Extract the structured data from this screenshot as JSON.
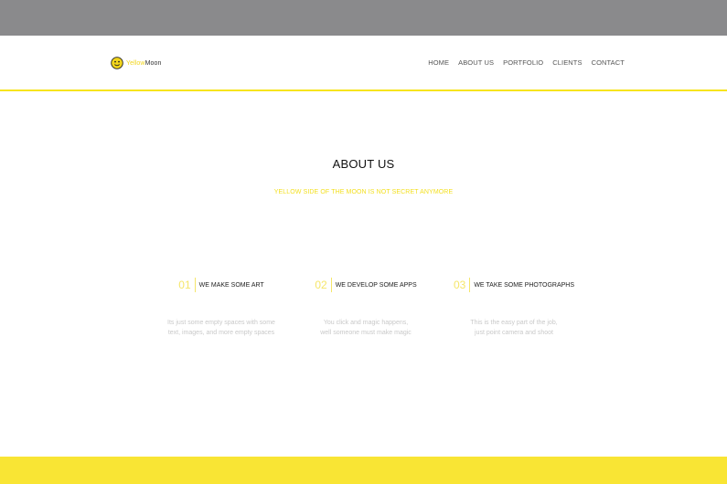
{
  "header": {
    "logo": {
      "word1": "Yellow",
      "word2": "Moon"
    },
    "nav": [
      "HOME",
      "ABOUT US",
      "PORTFOLIO",
      "CLIENTS",
      "CONTACT"
    ]
  },
  "main": {
    "title": "ABOUT US",
    "subtitle": "YELLOW SIDE OF THE MOON IS NOT SECRET ANYMORE",
    "services": [
      {
        "num": "01",
        "title": "WE MAKE SOME ART",
        "desc_line1": "Its just some empty spaces with some",
        "desc_line2": "text, images, and more empty spaces"
      },
      {
        "num": "02",
        "title": "WE DEVELOP SOME APPS",
        "desc_line1": "You click and magic happens,",
        "desc_line2": "well someone must make magic"
      },
      {
        "num": "03",
        "title": "WE TAKE SOME PHOTOGRAPHS",
        "desc_line1": "This is the easy part of the job,",
        "desc_line2": "just point camera and shoot"
      }
    ]
  },
  "colors": {
    "accent": "#f7e41e",
    "topbar": "#8a8a8c",
    "footer": "#f9e534"
  }
}
